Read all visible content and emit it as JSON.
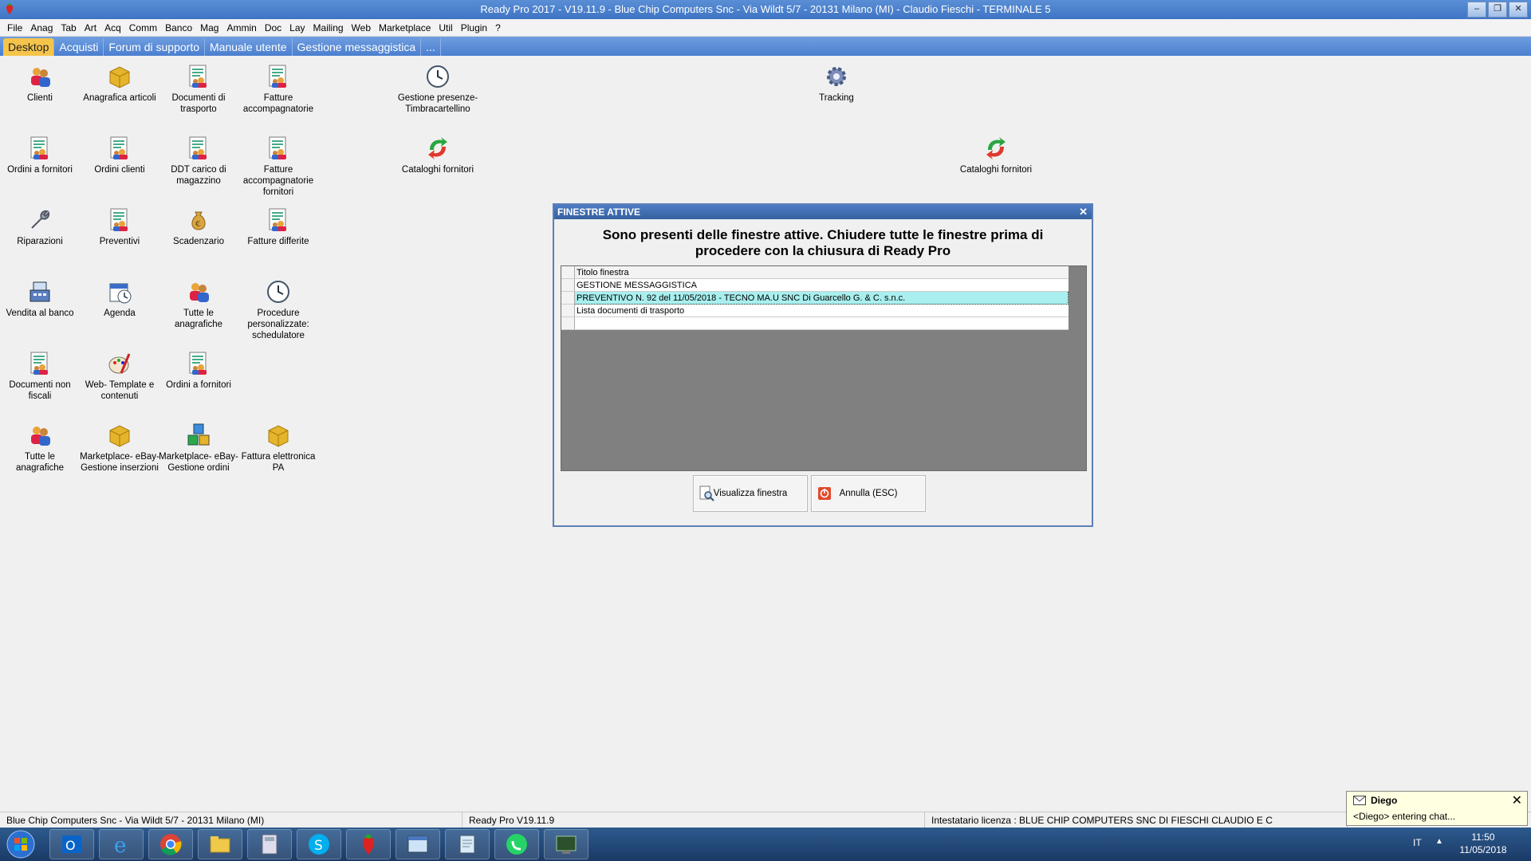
{
  "window": {
    "title": "Ready Pro 2017 - V19.11.9 - Blue Chip Computers Snc - Via Wildt 5/7 - 20131 Milano (MI) - Claudio Fieschi - TERMINALE 5",
    "minimize": "–",
    "maximize": "❐",
    "close": "✕"
  },
  "menu": [
    "File",
    "Anag",
    "Tab",
    "Art",
    "Acq",
    "Comm",
    "Banco",
    "Mag",
    "Ammin",
    "Doc",
    "Lay",
    "Mailing",
    "Web",
    "Marketplace",
    "Util",
    "Plugin",
    "?"
  ],
  "tabs": [
    "Desktop",
    "Acquisti",
    "Forum di supporto",
    "Manuale utente",
    "Gestione messaggistica",
    "..."
  ],
  "desktop_icons": [
    {
      "label": "Clienti",
      "icon": "people-icon"
    },
    {
      "label": "Anagrafica articoli",
      "icon": "box-icon"
    },
    {
      "label": "Documenti di trasporto",
      "icon": "document-people-icon"
    },
    {
      "label": "Fatture accompagnatorie",
      "icon": "document-people-icon"
    },
    {
      "label": "Gestione presenze-Timbracartellino",
      "icon": "clock-icon"
    },
    {
      "label": "Tracking",
      "icon": "gear-icon"
    },
    {
      "label": "Ordini a fornitori",
      "icon": "document-people-icon"
    },
    {
      "label": "Ordini clienti",
      "icon": "document-people-icon"
    },
    {
      "label": "DDT carico di magazzino",
      "icon": "document-people-icon"
    },
    {
      "label": "Fatture accompagnatorie fornitori",
      "icon": "document-people-icon"
    },
    {
      "label": "Cataloghi fornitori",
      "icon": "exchange-arrows-icon"
    },
    {
      "label": "Cataloghi fornitori",
      "icon": "exchange-arrows-icon"
    },
    {
      "label": "Riparazioni",
      "icon": "wrench-icon"
    },
    {
      "label": "Preventivi",
      "icon": "document-people-icon"
    },
    {
      "label": "Scadenzario",
      "icon": "money-bag-icon"
    },
    {
      "label": "Fatture differite",
      "icon": "document-people-icon"
    },
    {
      "label": "Vendita al banco",
      "icon": "cash-register-icon"
    },
    {
      "label": "Agenda",
      "icon": "calendar-icon"
    },
    {
      "label": "Tutte le anagrafiche",
      "icon": "people-icon"
    },
    {
      "label": "Procedure personalizzate: schedulatore",
      "icon": "clock-icon"
    },
    {
      "label": "Documenti non fiscali",
      "icon": "document-people-icon"
    },
    {
      "label": "Web- Template e contenuti",
      "icon": "palette-icon"
    },
    {
      "label": "Ordini a fornitori",
      "icon": "document-people-icon"
    },
    {
      "label": "Tutte le anagrafiche",
      "icon": "people-icon"
    },
    {
      "label": "Marketplace- eBay-Gestione inserzioni",
      "icon": "box-icon"
    },
    {
      "label": "Marketplace- eBay-Gestione ordini",
      "icon": "boxes-icon"
    },
    {
      "label": "Fattura elettronica PA",
      "icon": "box-icon"
    }
  ],
  "dialog": {
    "title": "FINESTRE ATTIVE",
    "close": "✕",
    "message_line1": "Sono presenti delle finestre attive. Chiudere tutte le finestre prima di",
    "message_line2": "procedere con la chiusura di Ready Pro",
    "list_header": "Titolo finestra",
    "rows": [
      "GESTIONE MESSAGGISTICA",
      "PREVENTIVO N. 92 del 11/05/2018 - TECNO MA.U SNC Di Guarcello G. & C. s.n.c.",
      "Lista documenti di trasporto"
    ],
    "selected_row": 1,
    "view_button": "Visualizza finestra",
    "cancel_button": "Annulla (ESC)"
  },
  "status": {
    "company": "Blue Chip Computers Snc - Via Wildt 5/7 - 20131 Milano (MI)",
    "version": "Ready Pro V19.11.9",
    "license": "Intestatario licenza : BLUE CHIP COMPUTERS SNC DI FIESCHI CLAUDIO E C"
  },
  "chat": {
    "name": "Diego",
    "message": "<Diego> entering chat...",
    "close": "✕"
  },
  "taskbar": {
    "items": [
      "outlook-icon",
      "internet-explorer-icon",
      "chrome-icon",
      "file-explorer-icon",
      "calculator-icon",
      "skype-icon",
      "strawberry-app-icon",
      "window-app-icon",
      "notepad-icon",
      "whatsapp-icon",
      "terminal-app-icon"
    ],
    "language": "IT",
    "tray_arrow": "▲",
    "time": "11:50",
    "date": "11/05/2018"
  }
}
